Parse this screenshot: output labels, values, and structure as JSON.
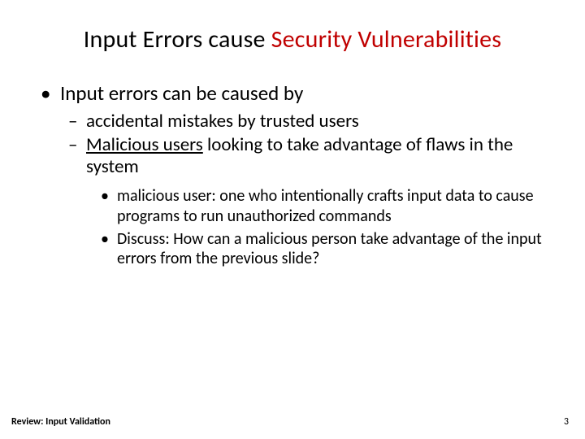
{
  "title_prefix": "Input Errors cause ",
  "title_highlight": "Security Vulnerabilities",
  "bullet1": "Input errors can be caused by",
  "sub1": "accidental mistakes by trusted users",
  "sub2_underlined": "Malicious users",
  "sub2_rest": " looking to take advantage of flaws in the system",
  "subsub1": "malicious user:  one who intentionally crafts input data to cause programs to run unauthorized commands",
  "subsub2": "Discuss: How can a malicious person take advantage of the input errors from the previous slide?",
  "footer_left": "Review: Input Validation",
  "page_number": "3"
}
